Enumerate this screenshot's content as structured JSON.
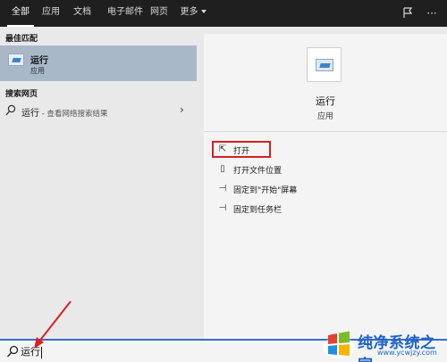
{
  "tabs": [
    {
      "label": "全部",
      "active": true
    },
    {
      "label": "应用"
    },
    {
      "label": "文档"
    },
    {
      "label": "电子邮件"
    },
    {
      "label": "网页"
    },
    {
      "label": "更多"
    }
  ],
  "topbar": {
    "feedback_icon": "feedback-icon",
    "more_icon": "ellipsis-icon",
    "more_glyph": "···"
  },
  "left": {
    "best_match_heading": "最佳匹配",
    "best_match": {
      "title": "运行",
      "subtitle": "应用",
      "icon": "run-app-icon"
    },
    "web_heading": "搜索网页",
    "web_result": {
      "text": "运行",
      "suffix": " - 查看网络搜索结果",
      "icon": "search-icon",
      "chevron": "›"
    }
  },
  "detail": {
    "title": "运行",
    "subtitle": "应用",
    "actions": [
      {
        "label": "打开",
        "icon": "open-icon",
        "glyph": "⇱"
      },
      {
        "label": "打开文件位置",
        "icon": "file-location-icon",
        "glyph": "▯"
      },
      {
        "label": "固定到\"开始\"屏幕",
        "icon": "pin-icon",
        "glyph": "⊣"
      },
      {
        "label": "固定到任务栏",
        "icon": "pin-icon",
        "glyph": "⊣"
      }
    ]
  },
  "search": {
    "value": "运行"
  },
  "watermark": {
    "brand": "纯净系统之家",
    "url": "www.ycwjzy.com"
  },
  "colors": {
    "accent": "#3a6ad0",
    "selection": "#a9b8c9",
    "annotation": "#d82020",
    "topbar": "#1f1f1f"
  }
}
